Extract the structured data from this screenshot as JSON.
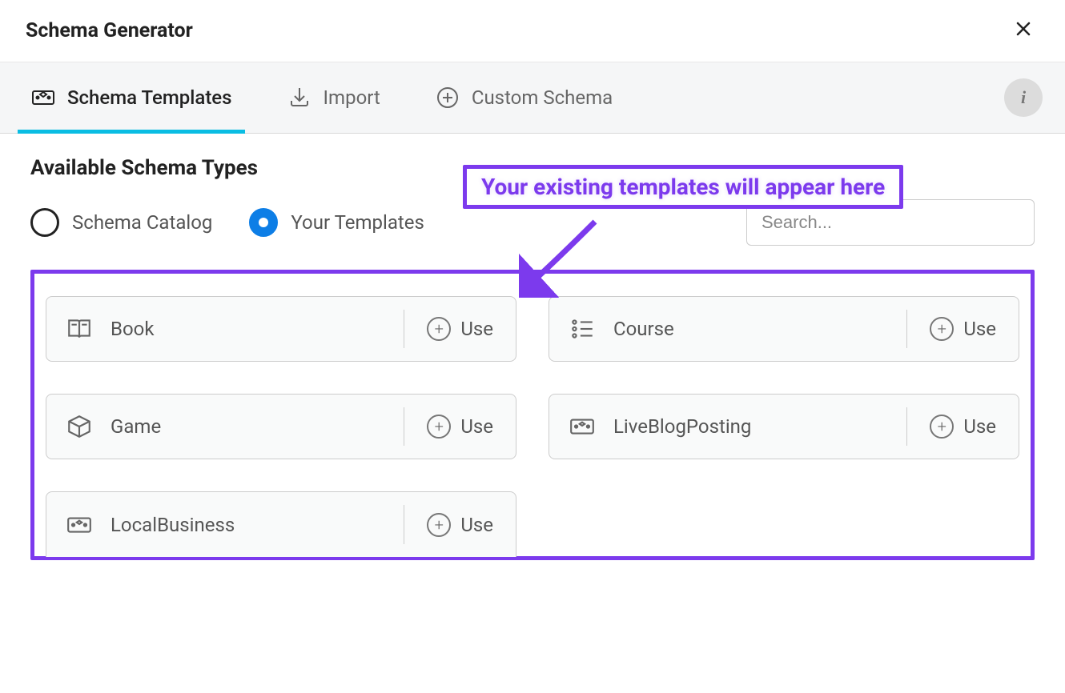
{
  "header": {
    "title": "Schema Generator"
  },
  "tabs": {
    "schema_templates": "Schema Templates",
    "import": "Import",
    "custom_schema": "Custom Schema",
    "active": "schema_templates"
  },
  "section": {
    "heading": "Available Schema Types"
  },
  "radios": {
    "catalog": "Schema Catalog",
    "your_templates": "Your Templates",
    "selected": "your_templates"
  },
  "search": {
    "placeholder": "Search..."
  },
  "annotation": {
    "text": "Your existing templates will appear here"
  },
  "use_label": "Use",
  "templates": [
    {
      "name": "Book",
      "icon": "book-icon"
    },
    {
      "name": "Course",
      "icon": "list-icon"
    },
    {
      "name": "Game",
      "icon": "box-icon"
    },
    {
      "name": "LiveBlogPosting",
      "icon": "ticket-icon"
    },
    {
      "name": "LocalBusiness",
      "icon": "ticket-icon"
    }
  ]
}
